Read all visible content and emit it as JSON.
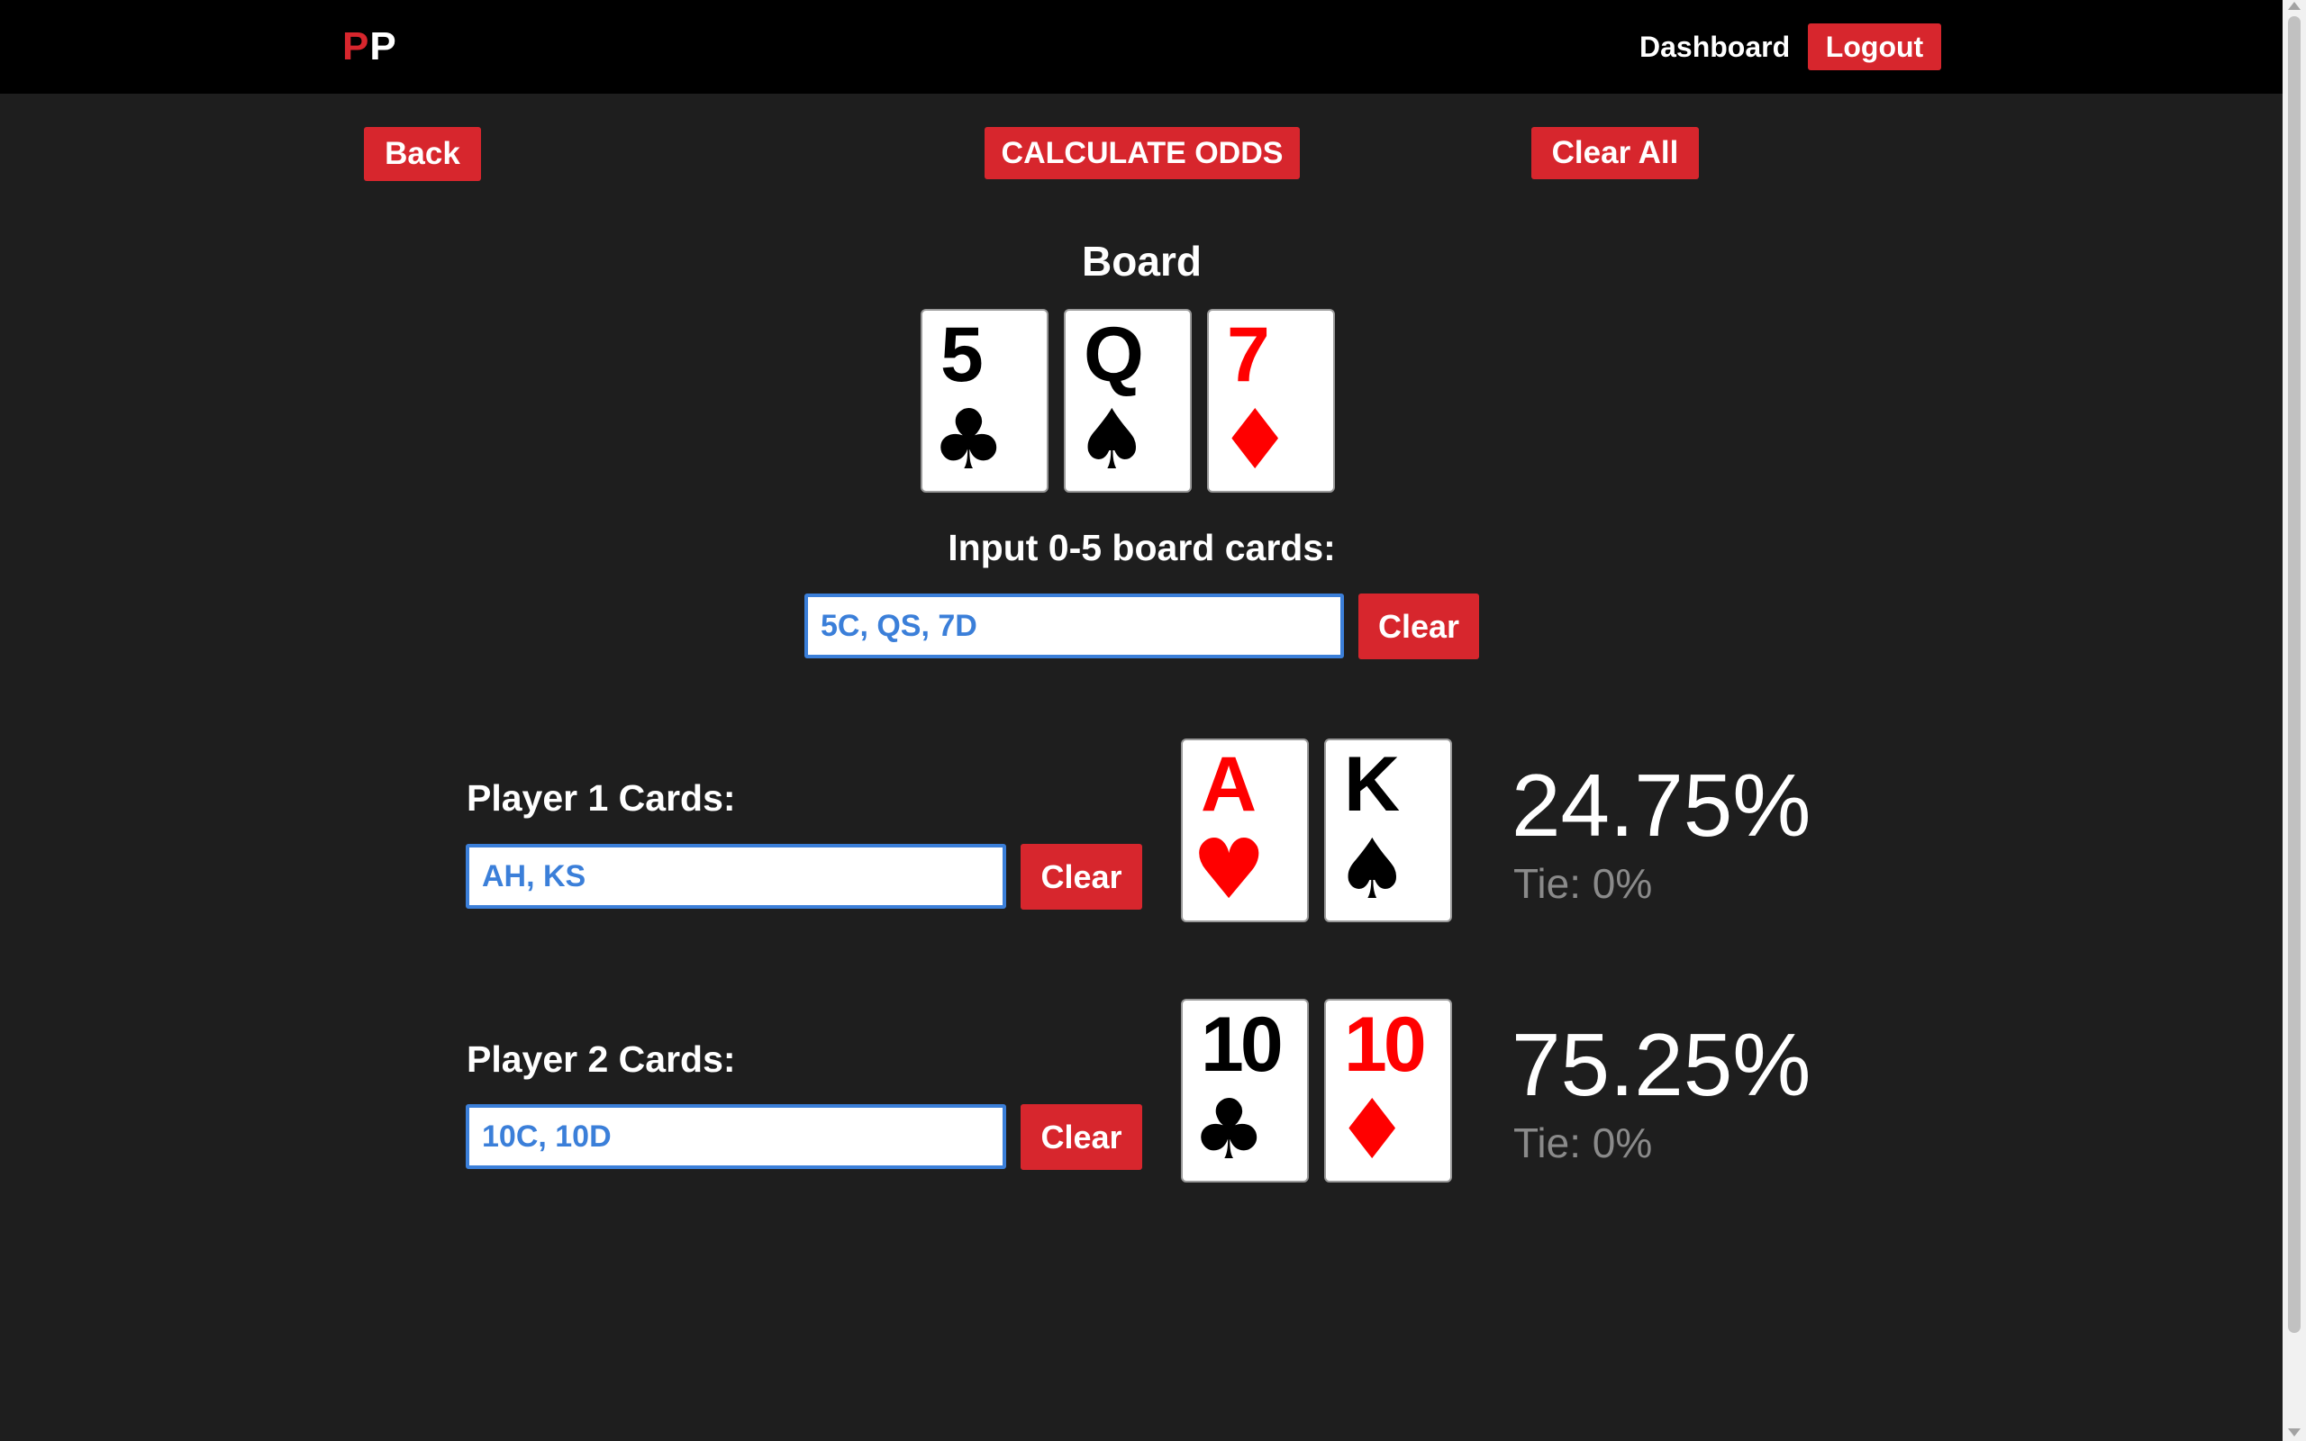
{
  "nav": {
    "logo_first": "P",
    "logo_second": "P",
    "dashboard_label": "Dashboard",
    "logout_label": "Logout"
  },
  "toolbar": {
    "back_label": "Back",
    "calculate_label": "CALCULATE ODDS",
    "clear_all_label": "Clear All"
  },
  "board": {
    "title": "Board",
    "input_label": "Input 0-5 board cards:",
    "input_value": "5C, QS, 7D",
    "clear_label": "Clear",
    "cards": [
      {
        "rank": "5",
        "suit": "♣",
        "color": "#000000"
      },
      {
        "rank": "Q",
        "suit": "♠",
        "color": "#000000"
      },
      {
        "rank": "7",
        "suit": "♦",
        "color": "#ff0000"
      }
    ]
  },
  "players": [
    {
      "label": "Player 1 Cards:",
      "input_value": "AH, KS",
      "clear_label": "Clear",
      "cards": [
        {
          "rank": "A",
          "suit": "♥",
          "color": "#ff0000"
        },
        {
          "rank": "K",
          "suit": "♠",
          "color": "#000000"
        }
      ],
      "win": "24.75%",
      "tie": "Tie: 0%"
    },
    {
      "label": "Player 2 Cards:",
      "input_value": "10C, 10D",
      "clear_label": "Clear",
      "cards": [
        {
          "rank": "10",
          "suit": "♣",
          "color": "#000000"
        },
        {
          "rank": "10",
          "suit": "♦",
          "color": "#ff0000"
        }
      ],
      "win": "75.25%",
      "tie": "Tie: 0%"
    }
  ],
  "colors": {
    "accent": "#d7262d",
    "background": "#1e1e1e",
    "navbar": "#000000",
    "input_text": "#3b7fd9",
    "tie_text": "#8a8a8a"
  }
}
